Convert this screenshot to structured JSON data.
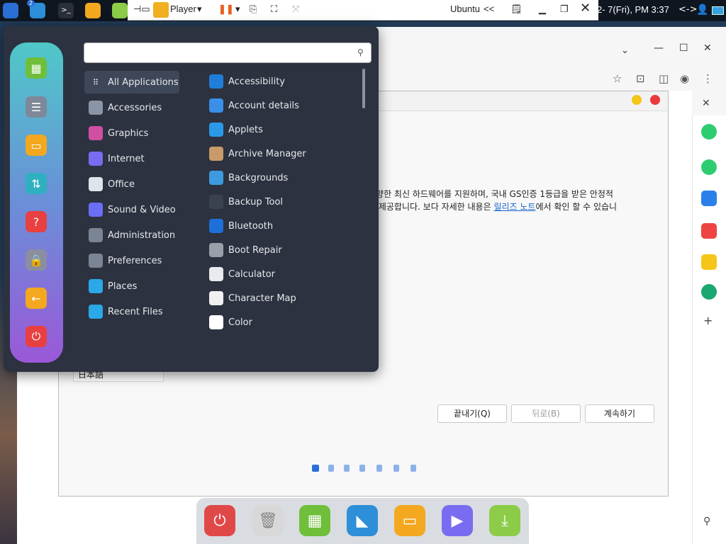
{
  "panel": {
    "clock": "2- 7(Fri), PM 3:37",
    "arrows": "<->",
    "notify_badge": "2"
  },
  "vm_toolbar": {
    "player_label": "Player",
    "vm_name": "Ubuntu",
    "vm_arrows": "<<"
  },
  "installer": {
    "line1": "다양한 최신 하드웨어를 지원하며, 국내 GS인증 1등급을 받은 안정적",
    "line2_pre": "를 제공합니다. 보다 자세한 내용은 ",
    "line2_link": "릴리즈 노트",
    "line2_post": "에서 확인 할 수 있습니",
    "language_item": "日本語",
    "quit_button": "끝내기(Q)",
    "back_button": "뒤로(B)",
    "continue_button": "계속하기"
  },
  "menu": {
    "search_value": "",
    "categories": [
      {
        "label": "All Applications",
        "icon": "grid-icon",
        "color": "#3e4758"
      },
      {
        "label": "Accessories",
        "icon": "accessories-icon",
        "color": "#8a95a8"
      },
      {
        "label": "Graphics",
        "icon": "graphics-icon",
        "color": "#d04fa0"
      },
      {
        "label": "Internet",
        "icon": "internet-icon",
        "color": "#7a6cf0"
      },
      {
        "label": "Office",
        "icon": "office-icon",
        "color": "#dfe3ea"
      },
      {
        "label": "Sound & Video",
        "icon": "sound-video-icon",
        "color": "#6b6ef5"
      },
      {
        "label": "Administration",
        "icon": "administration-icon",
        "color": "#7b8494"
      },
      {
        "label": "Preferences",
        "icon": "preferences-icon",
        "color": "#7b8494"
      },
      {
        "label": "Places",
        "icon": "folder-icon",
        "color": "#2aa8e8"
      },
      {
        "label": "Recent Files",
        "icon": "recent-folder-icon",
        "color": "#2aa8e8"
      }
    ],
    "apps": [
      {
        "label": "Accessibility",
        "icon": "accessibility-icon",
        "color": "#1f7fd8"
      },
      {
        "label": "Account details",
        "icon": "account-icon",
        "color": "#3a8fe8"
      },
      {
        "label": "Applets",
        "icon": "applets-icon",
        "color": "#2a9ae8"
      },
      {
        "label": "Archive Manager",
        "icon": "archive-icon",
        "color": "#c99a6a"
      },
      {
        "label": "Backgrounds",
        "icon": "backgrounds-icon",
        "color": "#3e9ae0"
      },
      {
        "label": "Backup Tool",
        "icon": "backup-icon",
        "color": "#3a4250"
      },
      {
        "label": "Bluetooth",
        "icon": "bluetooth-icon",
        "color": "#1f6fd8"
      },
      {
        "label": "Boot Repair",
        "icon": "boot-repair-icon",
        "color": "#9aa0aa"
      },
      {
        "label": "Calculator",
        "icon": "calculator-icon",
        "color": "#e8eaee"
      },
      {
        "label": "Character Map",
        "icon": "character-map-icon",
        "color": "#f0f0f0"
      },
      {
        "label": "Color",
        "icon": "color-icon",
        "color": "#ffffff"
      }
    ]
  }
}
